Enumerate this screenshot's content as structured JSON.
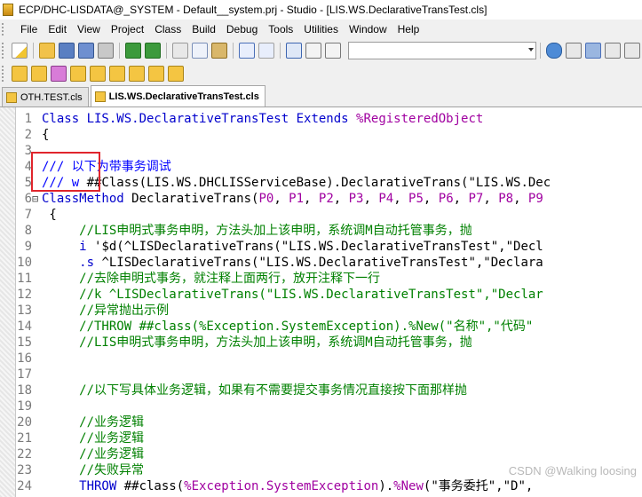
{
  "window": {
    "title": "ECP/DHC-LISDATA@_SYSTEM - Default__system.prj - Studio - [LIS.WS.DeclarativeTransTest.cls]"
  },
  "menu": {
    "items": [
      "File",
      "Edit",
      "View",
      "Project",
      "Class",
      "Build",
      "Debug",
      "Tools",
      "Utilities",
      "Window",
      "Help"
    ]
  },
  "tabs": [
    {
      "label": "OTH.TEST.cls",
      "active": false
    },
    {
      "label": "LIS.WS.DeclarativeTransTest.cls",
      "active": true
    }
  ],
  "code": {
    "lines": [
      {
        "n": "1",
        "segs": [
          [
            "kw",
            "Class "
          ],
          [
            "cls",
            "LIS.WS.DeclarativeTransTest "
          ],
          [
            "kw",
            "Extends "
          ],
          [
            "pct",
            "%RegisteredObject"
          ]
        ]
      },
      {
        "n": "2",
        "segs": [
          [
            "black",
            "{"
          ]
        ]
      },
      {
        "n": "3",
        "segs": []
      },
      {
        "n": "4",
        "segs": [
          [
            "blue",
            "/// 以下为带事务调试"
          ]
        ]
      },
      {
        "n": "5",
        "segs": [
          [
            "blue",
            "/// w "
          ],
          [
            "black",
            "##Class(LIS.WS.DHCLISServiceBase).DeclarativeTrans(\"LIS.WS.Dec"
          ]
        ]
      },
      {
        "n": "6",
        "fold": "⊟",
        "segs": [
          [
            "kw",
            "ClassMethod "
          ],
          [
            "black",
            "DeclarativeTrans("
          ],
          [
            "pct",
            "P0"
          ],
          [
            "black",
            ", "
          ],
          [
            "pct",
            "P1"
          ],
          [
            "black",
            ", "
          ],
          [
            "pct",
            "P2"
          ],
          [
            "black",
            ", "
          ],
          [
            "pct",
            "P3"
          ],
          [
            "black",
            ", "
          ],
          [
            "pct",
            "P4"
          ],
          [
            "black",
            ", "
          ],
          [
            "pct",
            "P5"
          ],
          [
            "black",
            ", "
          ],
          [
            "pct",
            "P6"
          ],
          [
            "black",
            ", "
          ],
          [
            "pct",
            "P7"
          ],
          [
            "black",
            ", "
          ],
          [
            "pct",
            "P8"
          ],
          [
            "black",
            ", "
          ],
          [
            "pct",
            "P9"
          ]
        ]
      },
      {
        "n": "7",
        "segs": [
          [
            "black",
            " {"
          ]
        ]
      },
      {
        "n": "8",
        "segs": [
          [
            "grn",
            "     //LIS申明式事务申明，方法头加上该申明，系统调M自动托管事务，抛"
          ]
        ]
      },
      {
        "n": "9",
        "segs": [
          [
            "kw",
            "     i "
          ],
          [
            "black",
            "'$d(^LISDeclarativeTrans(\"LIS.WS.DeclarativeTransTest\",\"Decl"
          ]
        ]
      },
      {
        "n": "10",
        "segs": [
          [
            "kw",
            "     .s "
          ],
          [
            "black",
            "^LISDeclarativeTrans(\"LIS.WS.DeclarativeTransTest\",\"Declara"
          ]
        ]
      },
      {
        "n": "11",
        "segs": [
          [
            "grn",
            "     //去除申明式事务，就注释上面两行，放开注释下一行"
          ]
        ]
      },
      {
        "n": "12",
        "segs": [
          [
            "grn",
            "     //k ^LISDeclarativeTrans(\"LIS.WS.DeclarativeTransTest\",\"Declar"
          ]
        ]
      },
      {
        "n": "13",
        "segs": [
          [
            "grn",
            "     //异常抛出示例"
          ]
        ]
      },
      {
        "n": "14",
        "segs": [
          [
            "grn",
            "     //THROW ##class(%Exception.SystemException).%New(\"名称\",\"代码\""
          ]
        ]
      },
      {
        "n": "15",
        "segs": [
          [
            "grn",
            "     //LIS申明式事务申明，方法头加上该申明，系统调M自动托管事务，抛"
          ]
        ]
      },
      {
        "n": "16",
        "segs": []
      },
      {
        "n": "17",
        "segs": []
      },
      {
        "n": "18",
        "segs": [
          [
            "grn",
            "     //以下写具体业务逻辑，如果有不需要提交事务情况直接按下面那样抛"
          ]
        ]
      },
      {
        "n": "19",
        "segs": []
      },
      {
        "n": "20",
        "segs": [
          [
            "grn",
            "     //业务逻辑"
          ]
        ]
      },
      {
        "n": "21",
        "segs": [
          [
            "grn",
            "     //业务逻辑"
          ]
        ]
      },
      {
        "n": "22",
        "segs": [
          [
            "grn",
            "     //业务逻辑"
          ]
        ]
      },
      {
        "n": "23",
        "segs": [
          [
            "grn",
            "     //失败异常"
          ]
        ]
      },
      {
        "n": "24",
        "segs": [
          [
            "kw",
            "     THROW "
          ],
          [
            "black",
            "##class("
          ],
          [
            "pct",
            "%Exception.SystemException"
          ],
          [
            "black",
            ")."
          ],
          [
            "pct",
            "%New"
          ],
          [
            "black",
            "(\"事务委托\",\"D\","
          ]
        ]
      }
    ]
  },
  "watermark": "CSDN @Walking loosing"
}
